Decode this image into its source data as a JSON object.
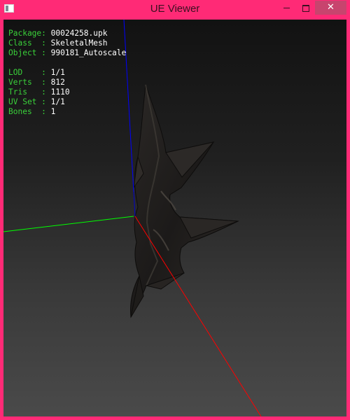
{
  "window": {
    "title": "UE Viewer",
    "controls": {
      "minimize": "minimize",
      "maximize": "maximize",
      "close": "✕"
    }
  },
  "info": {
    "package": {
      "key": "Package: ",
      "value": "00024258.upk"
    },
    "class": {
      "key": "Class  : ",
      "value": "SkeletalMesh"
    },
    "object": {
      "key": "Object : ",
      "value": "990181_Autoscale"
    },
    "lod": {
      "key": "LOD    : ",
      "value": "1/1"
    },
    "verts": {
      "key": "Verts  : ",
      "value": "812"
    },
    "tris": {
      "key": "Tris   : ",
      "value": "1110"
    },
    "uvset": {
      "key": "UV Set : ",
      "value": "1/1"
    },
    "bones": {
      "key": "Bones  : ",
      "value": "1"
    }
  },
  "colors": {
    "title_bar": "#ff2a76",
    "close_button": "#c8446e",
    "hud_label": "#3ad13a",
    "hud_value": "#ffffff",
    "axis_x": "#ff0000",
    "axis_y": "#00ff00",
    "axis_z": "#0000ff"
  }
}
